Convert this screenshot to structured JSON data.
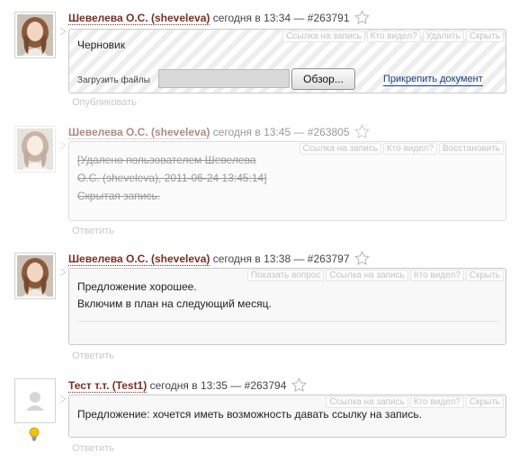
{
  "comments": [
    {
      "author": "Шевелева О.С. (sheveleva)",
      "time": "сегодня в 13:34 —",
      "id": "#263791",
      "actions": [
        "Ссылка на запись",
        "Кто видел?",
        "Удалить",
        "Скрыть"
      ],
      "draft_text": "Черновик",
      "upload_label": "Загрузить файлы",
      "browse_label": "Обзор...",
      "attach_label": "Прикрепить документ",
      "footer_action": "Опубликовать"
    },
    {
      "author": "Шевелева О.С. (sheveleva)",
      "time": "сегодня в 13:45 —",
      "id": "#263805",
      "actions": [
        "Ссылка на запись",
        "Кто видел?",
        "Восстановить"
      ],
      "lines": [
        "[Удалено пользователем Шевелева",
        "О.С. (sheveleva), 2011-06-24 13:45:14]",
        "Скрытая запись."
      ],
      "footer_action": "Ответить"
    },
    {
      "author": "Шевелева О.С. (sheveleva)",
      "time": "сегодня в 13:38 —",
      "id": "#263797",
      "actions": [
        "Показать вопрос",
        "Ссылка на запись",
        "Кто видел?",
        "Скрыть"
      ],
      "lines": [
        "Предложение хорошее.",
        "Включим в план на следующий месяц."
      ],
      "footer_action": "Ответить"
    },
    {
      "author": "Тест т.т. (Test1)",
      "time": "сегодня в 13:35 —",
      "id": "#263794",
      "actions": [
        "Ссылка на запись",
        "Кто видел?",
        "Скрыть"
      ],
      "lines": [
        "Предложение: хочется иметь возможность давать ссылку на запись."
      ],
      "footer_action": "Ответить"
    }
  ],
  "icons": {
    "star": "star-icon",
    "bulb": "lightbulb-icon",
    "avatar_default": "user-silhouette-icon"
  },
  "colors": {
    "author": "#7a2f22",
    "link": "#1a3c8c",
    "bulb": "#f2c20a"
  }
}
